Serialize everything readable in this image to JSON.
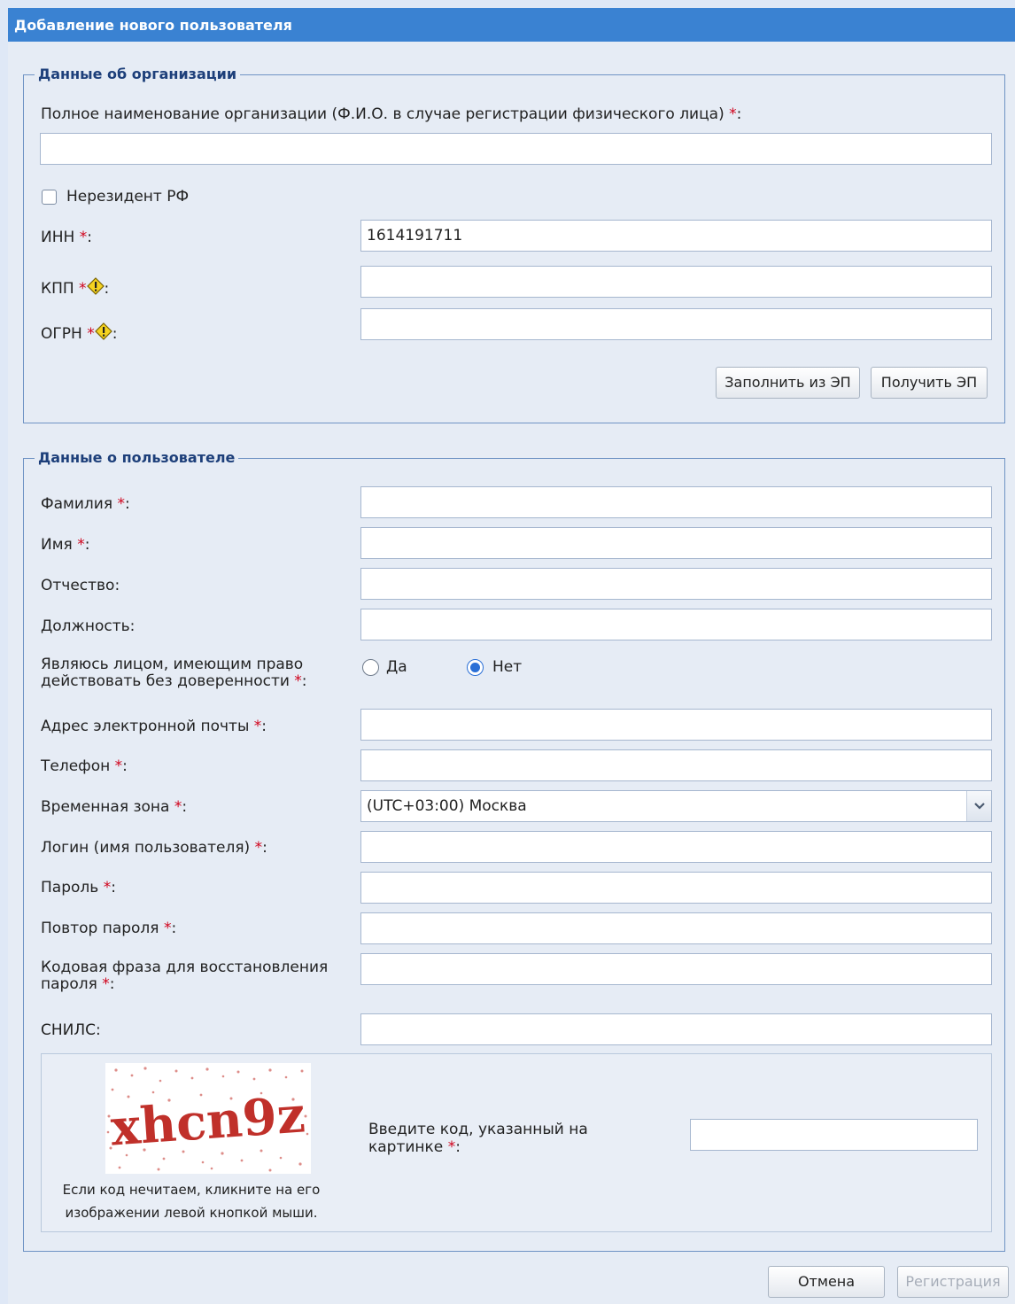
{
  "window": {
    "title": "Добавление нового пользователя"
  },
  "org": {
    "legend": "Данные об организации",
    "fullname_label": "Полное наименование организации (Ф.И.О. в случае регистрации физического лица)",
    "fullname_value": "",
    "nonresident_label": "Нерезидент РФ",
    "nonresident_checked": false,
    "inn_label": "ИНН",
    "inn_value": "1614191711",
    "kpp_label": "КПП",
    "kpp_value": "",
    "ogrn_label": "ОГРН",
    "ogrn_value": "",
    "fill_from_ep_button": "Заполнить из ЭП",
    "get_ep_button": "Получить ЭП"
  },
  "user": {
    "legend": "Данные о пользователе",
    "lastname_label": "Фамилия",
    "firstname_label": "Имя",
    "patronymic_label": "Отчество",
    "position_label": "Должность",
    "authority_label_line1": "Являюсь лицом, имеющим право",
    "authority_label_line2": "действовать без доверенности",
    "authority_yes": "Да",
    "authority_no": "Нет",
    "authority_selected": "Нет",
    "email_label": "Адрес электронной почты",
    "phone_label": "Телефон",
    "timezone_label": "Временная зона",
    "timezone_value": "(UTC+03:00) Москва",
    "login_label": "Логин (имя пользователя)",
    "password_label": "Пароль",
    "password_repeat_label": "Повтор пароля",
    "codephrase_label_line1": "Кодовая фраза для восстановления",
    "codephrase_label_line2": "пароля",
    "snils_label": "СНИЛС",
    "required_mark": "*",
    "colon": ":"
  },
  "captcha": {
    "image_text": "xhcn9z",
    "hint_line1": "Если код нечитаем, кликните на его",
    "hint_line2": "изображении левой кнопкой мыши.",
    "prompt_line1": "Введите код, указанный на",
    "prompt_line2": "картинке",
    "value": ""
  },
  "footer": {
    "cancel_button": "Отмена",
    "register_button": "Регистрация"
  }
}
